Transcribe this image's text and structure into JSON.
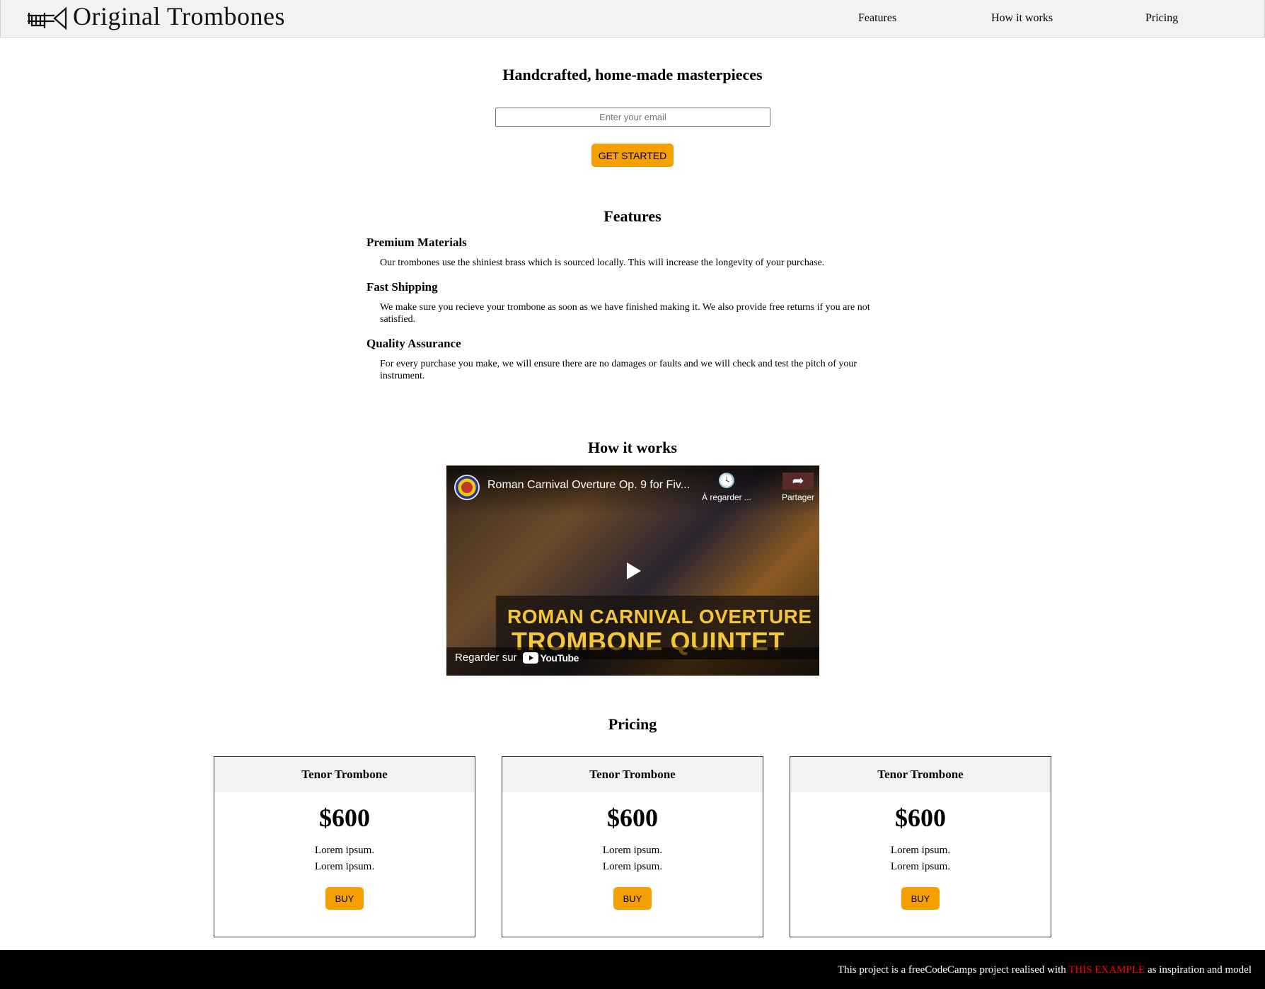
{
  "header": {
    "brand": "Original Trombones",
    "nav": [
      {
        "label": "Features"
      },
      {
        "label": "How it works"
      },
      {
        "label": "Pricing"
      }
    ]
  },
  "hero": {
    "title": "Handcrafted, home-made masterpieces",
    "email_placeholder": "Enter your email",
    "cta_label": "GET STARTED"
  },
  "features": {
    "title": "Features",
    "items": [
      {
        "heading": "Premium Materials",
        "text": "Our trombones use the shiniest brass which is sourced locally. This will increase the longevity of your purchase."
      },
      {
        "heading": "Fast Shipping",
        "text": "We make sure you recieve your trombone as soon as we have finished making it. We also provide free returns if you are not satisfied."
      },
      {
        "heading": "Quality Assurance",
        "text": "For every purchase you make, we will ensure there are no damages or faults and we will check and test the pitch of your instrument."
      }
    ]
  },
  "how_it_works": {
    "title": "How it works",
    "video": {
      "title": "Roman Carnival Overture Op. 9 for Fiv...",
      "watch_later": "À regarder ...",
      "share": "Partager",
      "banner_line1": "ROMAN CARNIVAL OVERTURE",
      "banner_line2": "TROMBONE QUINTET",
      "watch_on": "Regarder sur",
      "youtube": "YouTube"
    }
  },
  "pricing": {
    "title": "Pricing",
    "cards": [
      {
        "name": "Tenor Trombone",
        "price": "$600",
        "line1": "Lorem ipsum.",
        "line2": "Lorem ipsum.",
        "buy": "BUY"
      },
      {
        "name": "Tenor Trombone",
        "price": "$600",
        "line1": "Lorem ipsum.",
        "line2": "Lorem ipsum.",
        "buy": "BUY"
      },
      {
        "name": "Tenor Trombone",
        "price": "$600",
        "line1": "Lorem ipsum.",
        "line2": "Lorem ipsum.",
        "buy": "BUY"
      }
    ]
  },
  "footer": {
    "prefix": "This project is a freeCodeCamps project realised with",
    "link": "THIS EXAMPLE",
    "suffix": "as inspiration and model"
  },
  "colors": {
    "accent": "#f5a000",
    "header_bg": "#f2f2f2",
    "footer_bg": "#000000",
    "footer_link": "#ff0000"
  },
  "icons": {
    "logo": "trombone-icon",
    "play": "play-icon",
    "watch_later": "clock-icon",
    "share": "share-arrow-icon"
  }
}
